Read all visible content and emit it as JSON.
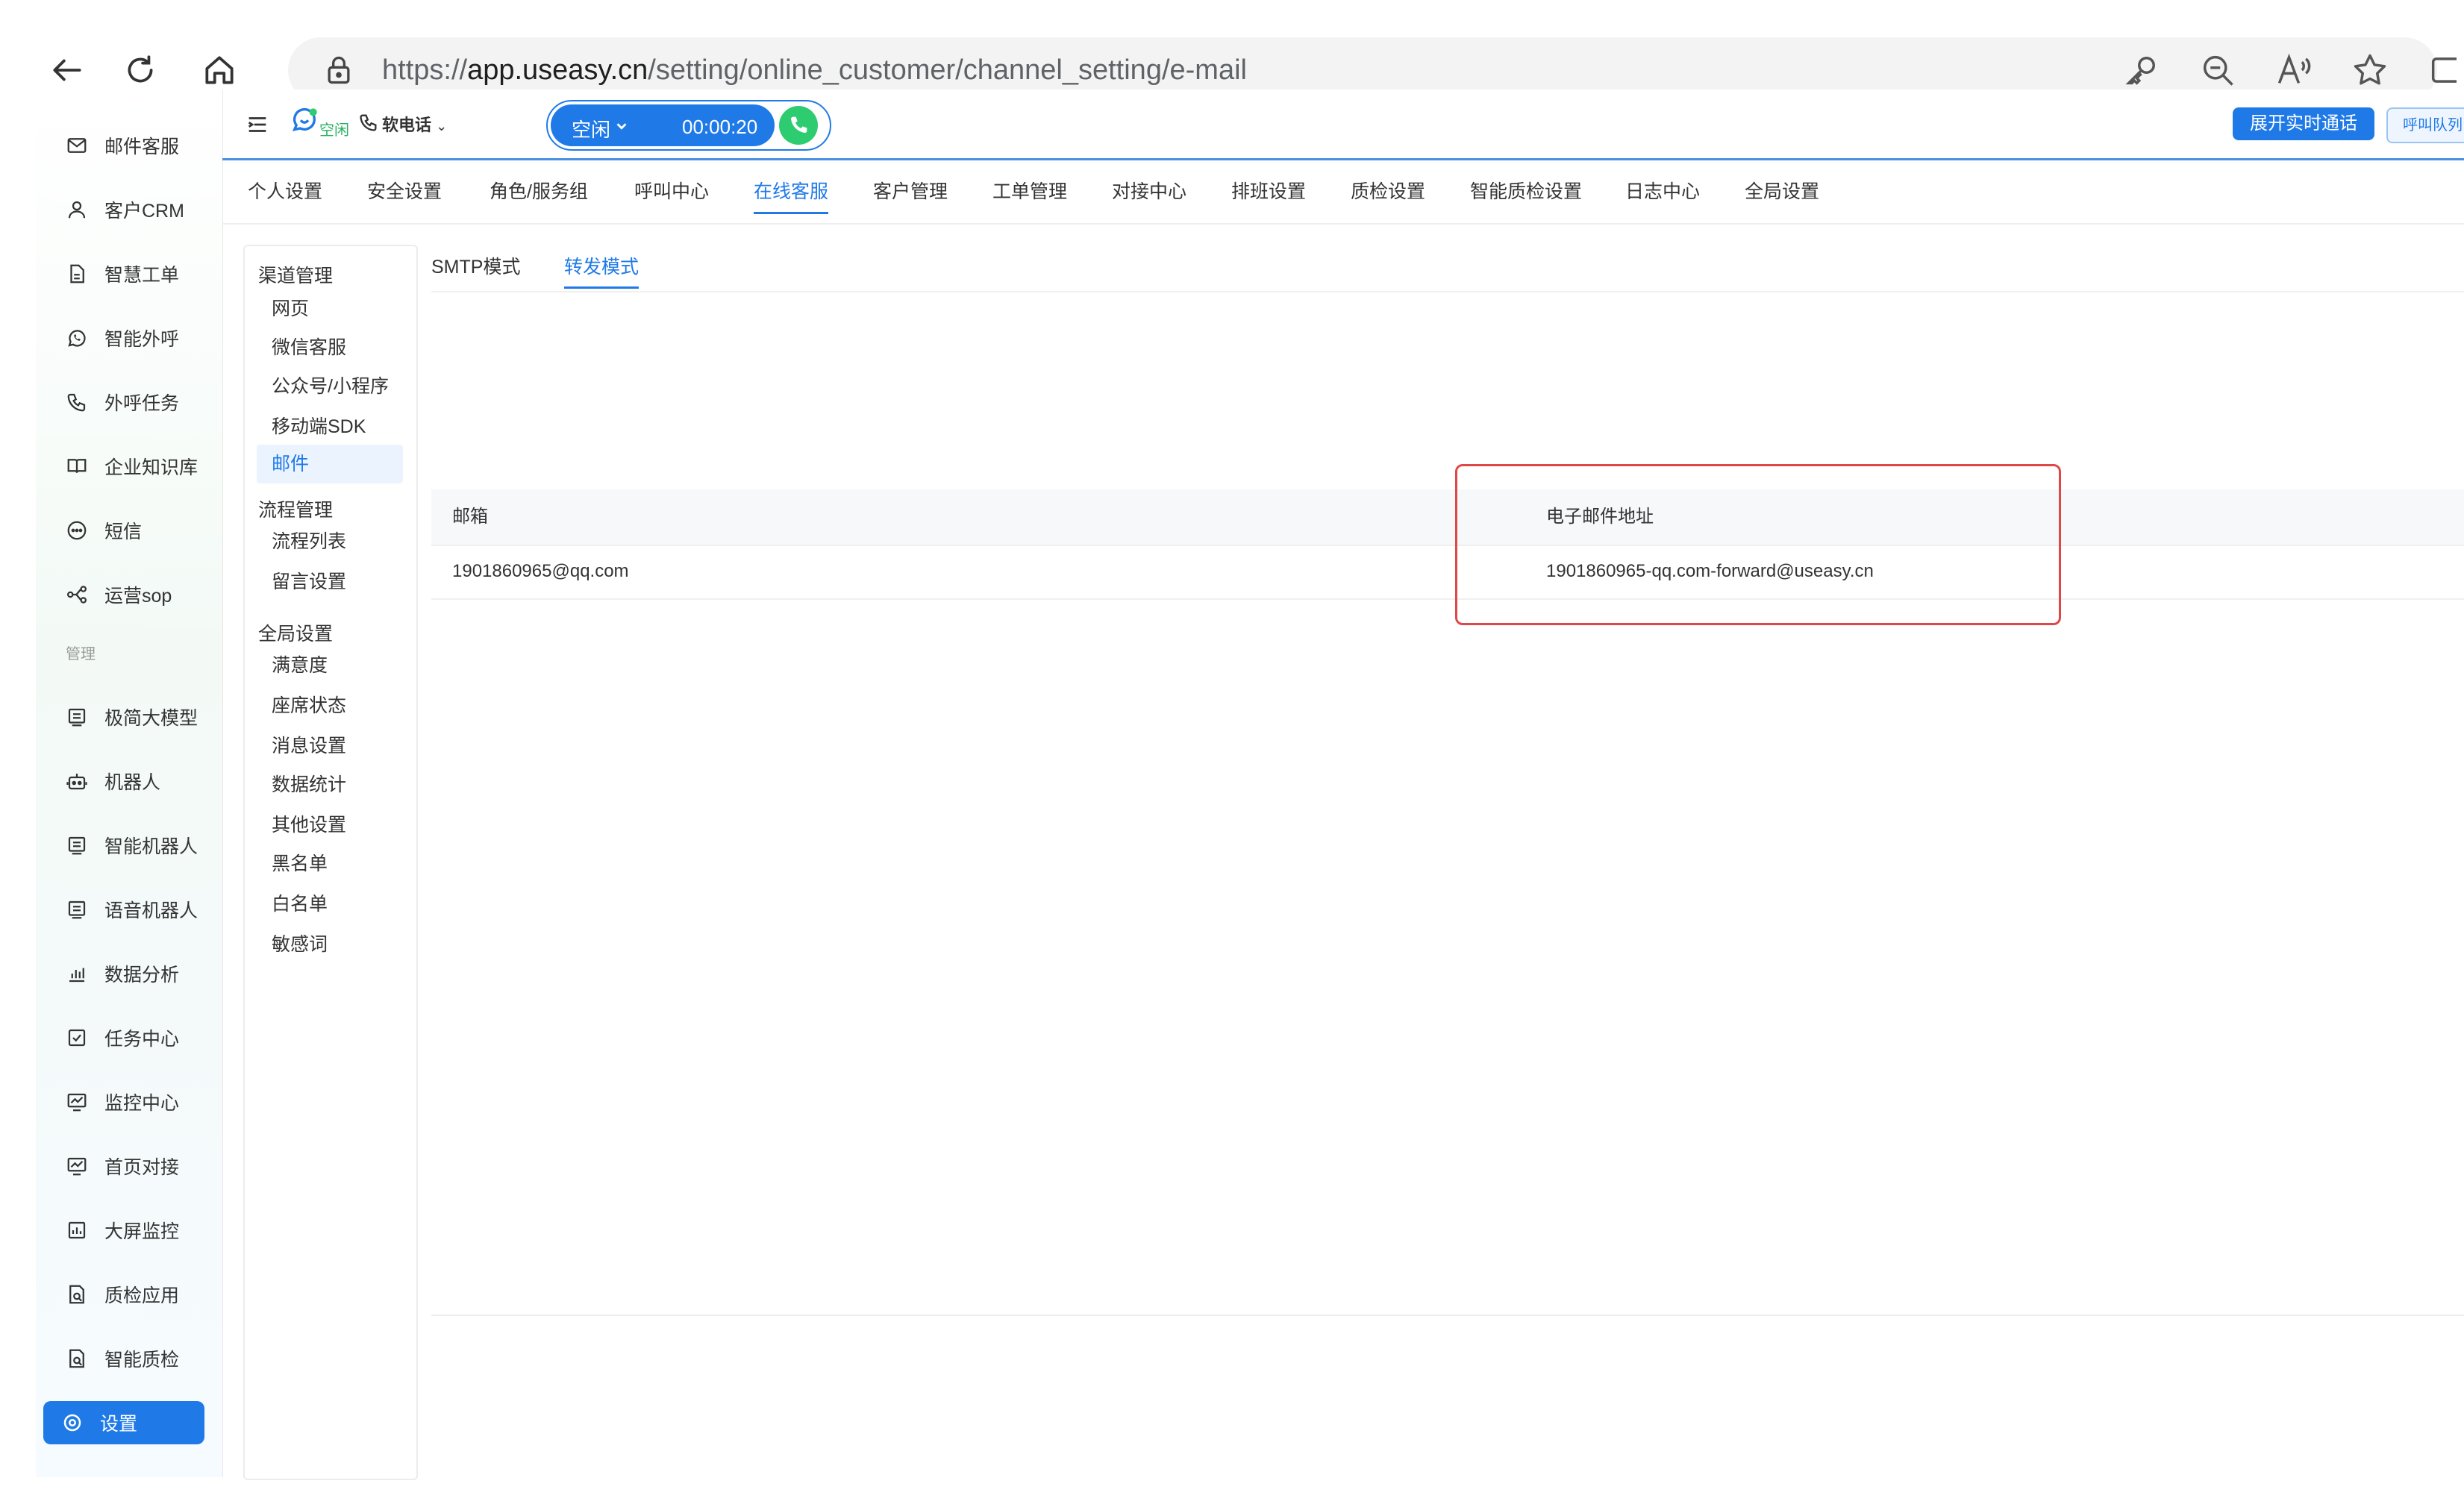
{
  "browser": {
    "url_prefix": "https://",
    "url_host": "app.useasy.cn",
    "url_path": "/setting/online_customer/channel_setting/e-mail"
  },
  "sidebar": {
    "items": [
      {
        "label": "邮件客服",
        "icon": "mail-icon"
      },
      {
        "label": "客户CRM",
        "icon": "user-icon"
      },
      {
        "label": "智慧工单",
        "icon": "document-icon"
      },
      {
        "label": "智能外呼",
        "icon": "whatsapp-icon"
      },
      {
        "label": "外呼任务",
        "icon": "phone-task-icon"
      },
      {
        "label": "企业知识库",
        "icon": "book-icon"
      },
      {
        "label": "短信",
        "icon": "sms-icon"
      },
      {
        "label": "运营sop",
        "icon": "flow-icon"
      }
    ],
    "group_label": "管理",
    "items2": [
      {
        "label": "极简大模型",
        "icon": "model-icon"
      },
      {
        "label": "机器人",
        "icon": "robot-icon"
      },
      {
        "label": "智能机器人",
        "icon": "smart-robot-icon"
      },
      {
        "label": "语音机器人",
        "icon": "voice-robot-icon"
      },
      {
        "label": "数据分析",
        "icon": "bar-chart-icon"
      },
      {
        "label": "任务中心",
        "icon": "task-icon"
      },
      {
        "label": "监控中心",
        "icon": "monitor-icon"
      },
      {
        "label": "首页对接",
        "icon": "home-monitor-icon"
      },
      {
        "label": "大屏监控",
        "icon": "screen-icon"
      },
      {
        "label": "质检应用",
        "icon": "qc-app-icon"
      },
      {
        "label": "智能质检",
        "icon": "smart-qc-icon"
      }
    ],
    "active_item": {
      "label": "设置",
      "icon": "settings-icon"
    }
  },
  "topbar": {
    "status_small": "空闲",
    "softphone_label": "软电话",
    "idle_label": "空闲",
    "timer": "00:00:20",
    "expand_call_label": "展开实时通话",
    "queue_label": "呼叫队列"
  },
  "tabs": [
    "个人设置",
    "安全设置",
    "角色/服务组",
    "呼叫中心",
    "在线客服",
    "客户管理",
    "工单管理",
    "对接中心",
    "排班设置",
    "质检设置",
    "智能质检设置",
    "日志中心",
    "全局设置"
  ],
  "active_tab": "在线客服",
  "submenu": {
    "group1": "渠道管理",
    "group1_items": [
      "网页",
      "微信客服",
      "公众号/小程序",
      "移动端SDK",
      "邮件"
    ],
    "group2": "流程管理",
    "group2_items": [
      "流程列表",
      "留言设置"
    ],
    "group3": "全局设置",
    "group3_items": [
      "满意度",
      "座席状态",
      "消息设置",
      "数据统计",
      "其他设置",
      "黑名单",
      "白名单",
      "敏感词"
    ],
    "active_item": "邮件"
  },
  "content": {
    "mode_tabs": [
      "SMTP模式",
      "转发模式"
    ],
    "active_mode": "转发模式",
    "table": {
      "headers": [
        "邮箱",
        "电子邮件地址"
      ],
      "rows": [
        [
          "1901860965@qq.com",
          "1901860965-qq.com-forward@useasy.cn"
        ]
      ]
    }
  },
  "colors": {
    "accent": "#1f7ae8",
    "highlight_box": "#e04848",
    "call_green": "#2ecc71"
  }
}
